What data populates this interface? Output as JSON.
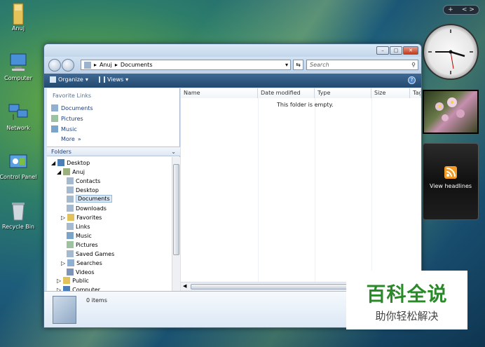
{
  "desktop_icons": [
    {
      "label": "Anuj",
      "icon": "user-folder-icon"
    },
    {
      "label": "Computer",
      "icon": "computer-icon"
    },
    {
      "label": "Network",
      "icon": "network-icon"
    },
    {
      "label": "Control Panel",
      "icon": "control-panel-icon"
    },
    {
      "label": "Recycle Bin",
      "icon": "recycle-bin-icon"
    }
  ],
  "sidebar": {
    "gadget_bar": {
      "add": "+",
      "nav": "<  >"
    },
    "feed_label": "View headlines"
  },
  "window": {
    "breadcrumb": [
      "Anuj",
      "Documents"
    ],
    "search_placeholder": "Search",
    "toolbar": {
      "organize": "Organize",
      "views": "Views"
    },
    "favorite_links_title": "Favorite Links",
    "favorite_links": [
      "Documents",
      "Pictures",
      "Music"
    ],
    "more_label": "More",
    "folders_title": "Folders",
    "tree": [
      {
        "label": "Desktop",
        "level": 0,
        "expanded": true
      },
      {
        "label": "Anuj",
        "level": 1,
        "expanded": true
      },
      {
        "label": "Contacts",
        "level": 2
      },
      {
        "label": "Desktop",
        "level": 2
      },
      {
        "label": "Documents",
        "level": 2,
        "selected": true
      },
      {
        "label": "Downloads",
        "level": 2
      },
      {
        "label": "Favorites",
        "level": 2,
        "collapsed": true
      },
      {
        "label": "Links",
        "level": 2
      },
      {
        "label": "Music",
        "level": 2
      },
      {
        "label": "Pictures",
        "level": 2
      },
      {
        "label": "Saved Games",
        "level": 2
      },
      {
        "label": "Searches",
        "level": 2,
        "collapsed": true
      },
      {
        "label": "Videos",
        "level": 2
      },
      {
        "label": "Public",
        "level": 1,
        "collapsed": true
      },
      {
        "label": "Computer",
        "level": 1,
        "collapsed": true
      }
    ],
    "columns": [
      "Name",
      "Date modified",
      "Type",
      "Size",
      "Tag"
    ],
    "empty_message": "This folder is empty.",
    "details_count": "0 items"
  },
  "watermark": {
    "title": "百科全说",
    "subtitle": "助你轻松解决"
  }
}
